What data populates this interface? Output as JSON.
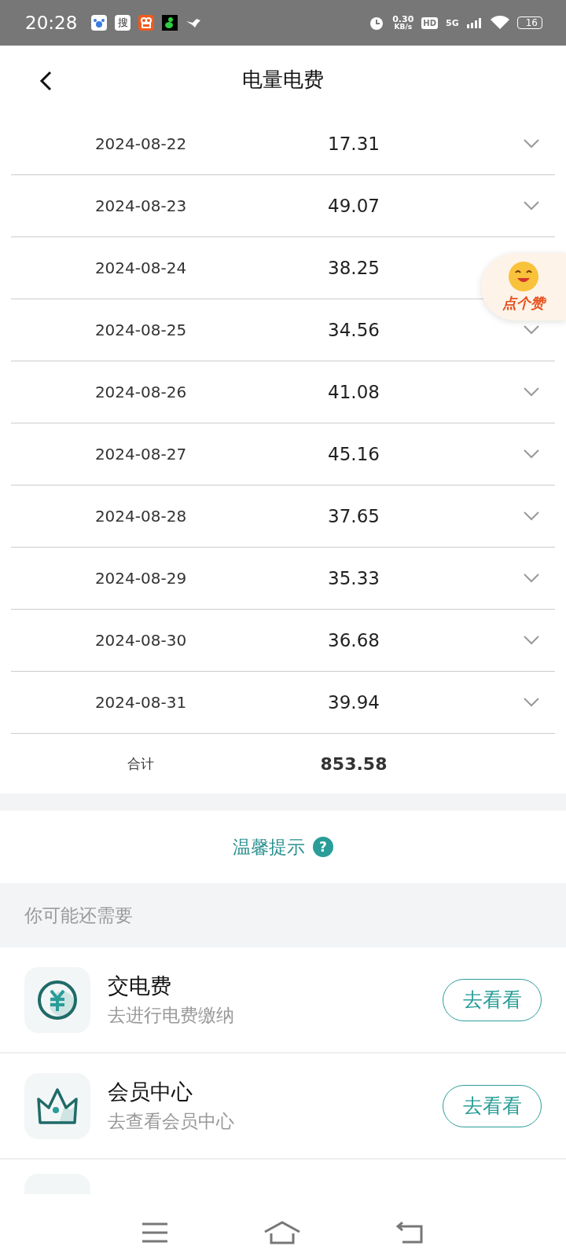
{
  "status_bar": {
    "time": "20:28",
    "search_app_glyph": "搜",
    "net_speed": "0.30",
    "net_unit": "KB/s",
    "hd": "HD",
    "network": "5G",
    "battery": "16"
  },
  "header": {
    "title": "电量电费"
  },
  "rows": [
    {
      "date": "2024-08-22",
      "value": "17.31"
    },
    {
      "date": "2024-08-23",
      "value": "49.07"
    },
    {
      "date": "2024-08-24",
      "value": "38.25",
      "chevron_covered": true
    },
    {
      "date": "2024-08-25",
      "value": "34.56"
    },
    {
      "date": "2024-08-26",
      "value": "41.08"
    },
    {
      "date": "2024-08-27",
      "value": "45.16"
    },
    {
      "date": "2024-08-28",
      "value": "37.65"
    },
    {
      "date": "2024-08-29",
      "value": "35.33"
    },
    {
      "date": "2024-08-30",
      "value": "36.68"
    },
    {
      "date": "2024-08-31",
      "value": "39.94"
    }
  ],
  "total": {
    "label": "合计",
    "value": "853.58"
  },
  "like_badge": {
    "label": "点个赞"
  },
  "tips": {
    "label": "温馨提示",
    "help": "?"
  },
  "suggestions": {
    "title": "你可能还需要",
    "items": [
      {
        "kind": "yuan",
        "title": "交电费",
        "subtitle": "去进行电费缴纳",
        "button": "去看看"
      },
      {
        "kind": "crown",
        "title": "会员中心",
        "subtitle": "去查看会员中心",
        "button": "去看看"
      }
    ]
  }
}
